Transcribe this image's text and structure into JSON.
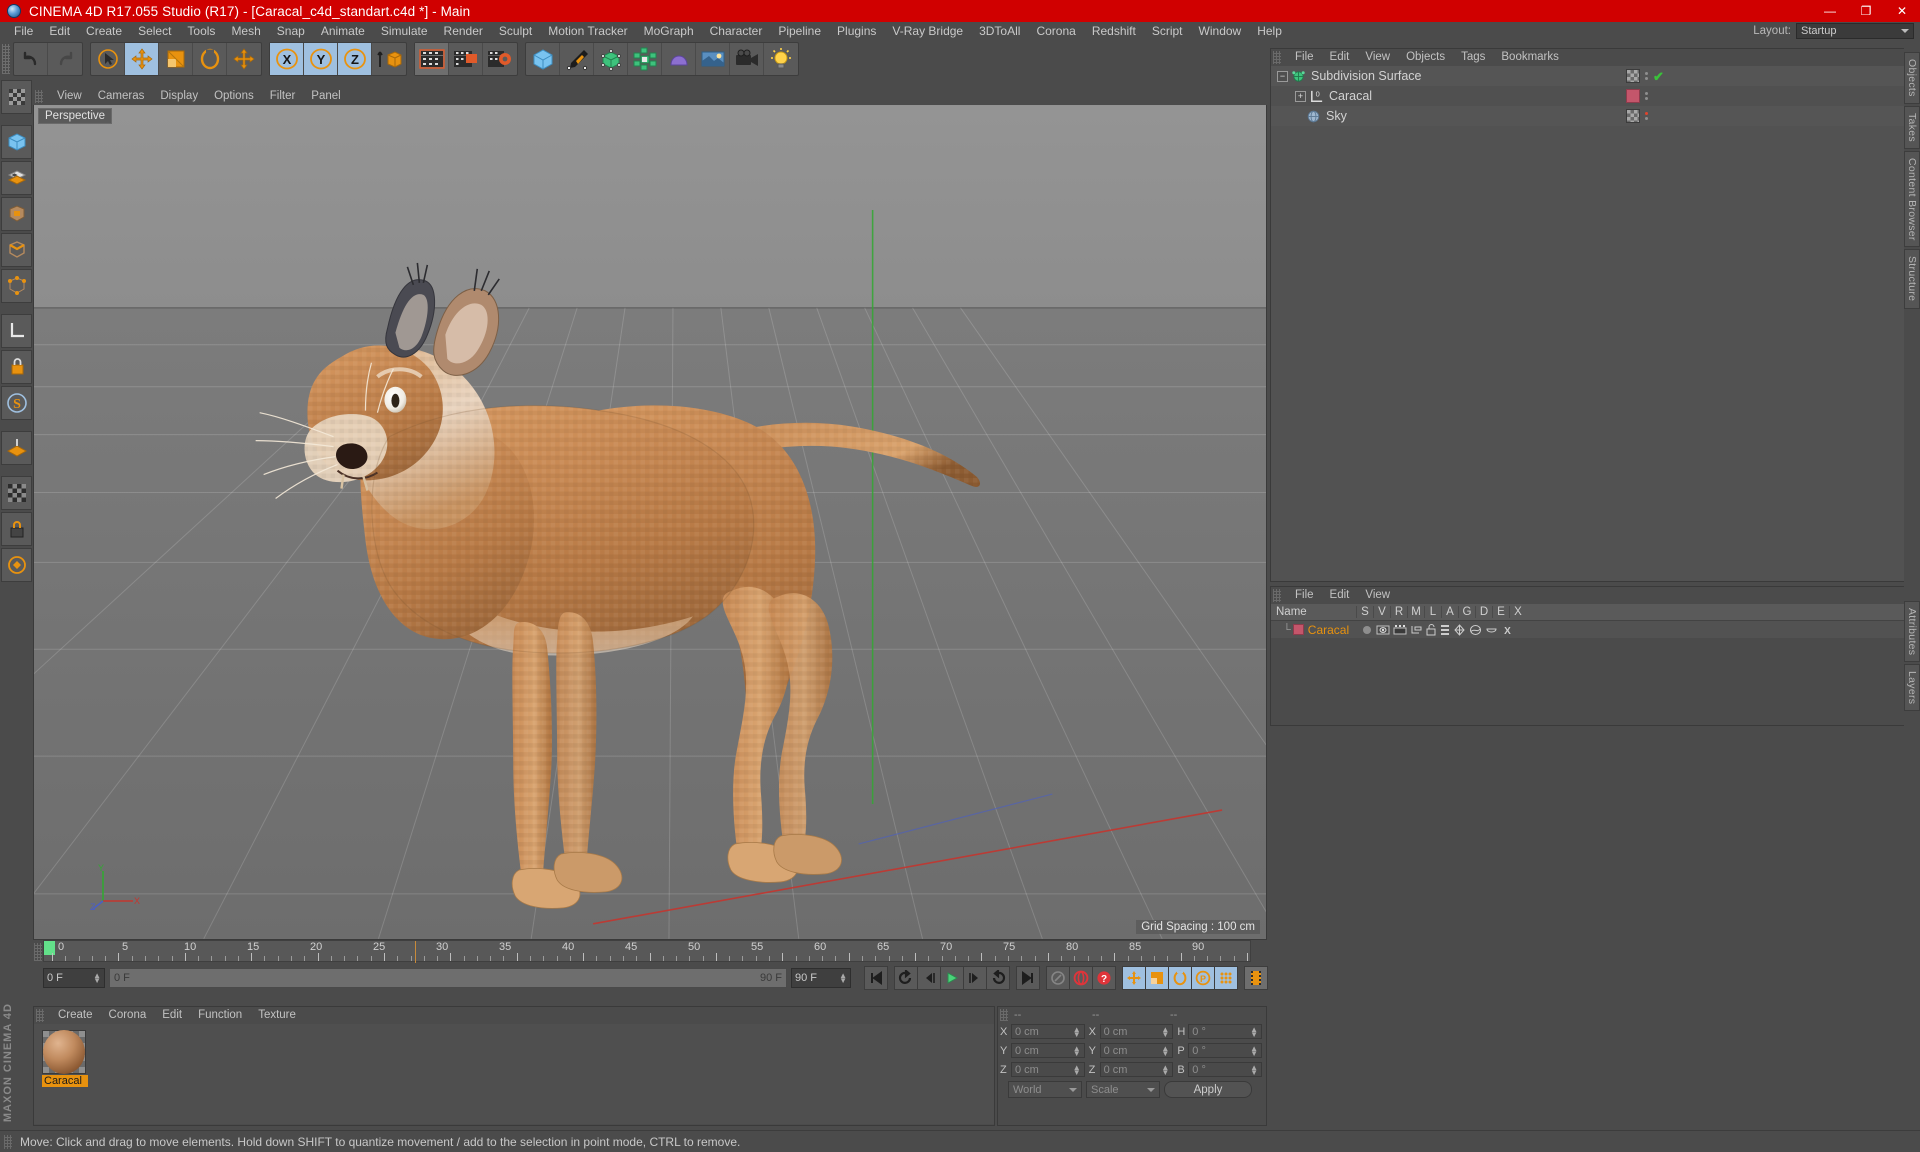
{
  "titlebar": {
    "title": "CINEMA 4D R17.055 Studio (R17) - [Caracal_c4d_standart.c4d *] - Main",
    "minimize": "—",
    "maximize": "❐",
    "close": "✕"
  },
  "menubar": {
    "items": [
      "File",
      "Edit",
      "Create",
      "Select",
      "Tools",
      "Mesh",
      "Snap",
      "Animate",
      "Simulate",
      "Render",
      "Sculpt",
      "Motion Tracker",
      "MoGraph",
      "Character",
      "Pipeline",
      "Plugins",
      "V-Ray Bridge",
      "3DToAll",
      "Corona",
      "Redshift",
      "Script",
      "Window",
      "Help"
    ],
    "layout_label": "Layout:",
    "layout_value": "Startup"
  },
  "toolbar": {
    "groups": [
      {
        "name": "history",
        "buttons": [
          {
            "name": "undo-button",
            "icon": "undo"
          },
          {
            "name": "redo-button",
            "icon": "redo"
          }
        ]
      },
      {
        "name": "modes",
        "buttons": [
          {
            "name": "select-tool-button",
            "icon": "cursor"
          },
          {
            "name": "move-tool-button",
            "icon": "move",
            "state": "selected"
          },
          {
            "name": "scale-tool-button",
            "icon": "scale"
          },
          {
            "name": "rotate-tool-button",
            "icon": "rotate"
          },
          {
            "name": "axis-tool-button",
            "icon": "axis"
          }
        ]
      },
      {
        "name": "axis-locks",
        "buttons": [
          {
            "name": "lock-x-button",
            "icon": "X",
            "state": "selected"
          },
          {
            "name": "lock-y-button",
            "icon": "Y",
            "state": "selected"
          },
          {
            "name": "lock-z-button",
            "icon": "Z",
            "state": "selected"
          },
          {
            "name": "world-object-coordinates-button",
            "icon": "world-axis"
          }
        ]
      },
      {
        "name": "render",
        "buttons": [
          {
            "name": "render-view-button",
            "icon": "clapper",
            "state": "active"
          },
          {
            "name": "render-to-picture-viewer-button",
            "icon": "clapper-pv"
          },
          {
            "name": "render-settings-button",
            "icon": "clapper-gear"
          }
        ]
      },
      {
        "name": "create",
        "buttons": [
          {
            "name": "add-cube-button",
            "icon": "cube-blue"
          },
          {
            "name": "add-spline-button",
            "icon": "pen"
          },
          {
            "name": "add-nurbs-button",
            "icon": "nurbs-green"
          },
          {
            "name": "add-array-button",
            "icon": "array-green"
          },
          {
            "name": "add-deformer-button",
            "icon": "deformer-purple"
          },
          {
            "name": "add-environment-button",
            "icon": "environment-blue"
          },
          {
            "name": "add-camera-button",
            "icon": "camera"
          },
          {
            "name": "add-light-button",
            "icon": "light-bulb"
          }
        ]
      }
    ]
  },
  "left_palette": {
    "buttons": [
      {
        "name": "texture-axis-button",
        "icon": "checker"
      },
      {
        "name": "model-mode-button",
        "icon": "model-cube"
      },
      {
        "name": "texture-mode-button",
        "icon": "texture-checker"
      },
      {
        "name": "polygon-mode-button",
        "icon": "polygon"
      },
      {
        "name": "edge-mode-button",
        "icon": "edge"
      },
      {
        "name": "point-mode-button",
        "icon": "point"
      },
      {
        "name": "enable-axis-button",
        "icon": "axis-L"
      },
      {
        "name": "lock-axis-button",
        "icon": "lock-axis"
      },
      {
        "name": "snap-settings-button",
        "icon": "snap-S"
      },
      {
        "name": "workplane-button",
        "icon": "workplane"
      },
      {
        "name": "viewport-solo-button",
        "icon": "solo-checker"
      },
      {
        "name": "lock-selection-button",
        "icon": "padlock"
      },
      {
        "name": "quantize-button",
        "icon": "quantize"
      }
    ],
    "brand": "MAXON CINEMA 4D"
  },
  "viewport": {
    "menu": [
      "View",
      "Cameras",
      "Display",
      "Options",
      "Filter",
      "Panel"
    ],
    "label": "Perspective",
    "grid_spacing": "Grid Spacing : 100 cm",
    "axis_labels": {
      "y": "Y",
      "x": "X",
      "z": "Z"
    }
  },
  "timeline": {
    "ruler_start": 0,
    "ruler_end": 90,
    "tick_labels": [
      "0",
      "5",
      "10",
      "15",
      "20",
      "25",
      "30",
      "35",
      "40",
      "45",
      "50",
      "55",
      "60",
      "65",
      "70",
      "75",
      "80",
      "85",
      "90"
    ],
    "current_frame": "0 F",
    "range_start": "0 F",
    "range_end": "90 F",
    "preview_end": "90 F",
    "playhead_frame": "0 F",
    "buttons": [
      {
        "name": "go-to-start-button",
        "icon": "skip-start"
      },
      {
        "name": "play-backwards-button",
        "icon": "rewind-round"
      },
      {
        "name": "previous-frame-button",
        "icon": "step-back"
      },
      {
        "name": "play-button",
        "icon": "play"
      },
      {
        "name": "next-frame-button",
        "icon": "step-forward"
      },
      {
        "name": "play-forward-loop-button",
        "icon": "loop"
      },
      {
        "name": "go-to-end-button",
        "icon": "skip-end"
      },
      {
        "name": "record-active-objects-button",
        "icon": "key-gray"
      },
      {
        "name": "autokeying-button",
        "icon": "record-red"
      },
      {
        "name": "keyframe-selection-button",
        "icon": "question-red"
      },
      {
        "name": "position-key-button",
        "icon": "move-key",
        "state": "selected"
      },
      {
        "name": "scale-key-button",
        "icon": "scale-key",
        "state": "selected"
      },
      {
        "name": "rotation-key-button",
        "icon": "rotate-key",
        "state": "selected"
      },
      {
        "name": "parameter-key-button",
        "icon": "param-key",
        "state": "selected"
      },
      {
        "name": "point-level-animation-button",
        "icon": "pla-dots",
        "state": "selected"
      },
      {
        "name": "timeline-view-button",
        "icon": "filmstrip",
        "state": "active"
      }
    ]
  },
  "material_manager": {
    "menu": [
      "Create",
      "Corona",
      "Edit",
      "Function",
      "Texture"
    ],
    "materials": [
      {
        "name": "Caracal"
      }
    ]
  },
  "coordinate_manager": {
    "header": [
      "--",
      "--",
      "--"
    ],
    "position": {
      "label_x": "X",
      "label_y": "Y",
      "label_z": "Z",
      "x": "0 cm",
      "y": "0 cm",
      "z": "0 cm"
    },
    "size": {
      "label_x": "X",
      "label_y": "Y",
      "label_z": "Z",
      "x": "0 cm",
      "y": "0 cm",
      "z": "0 cm"
    },
    "rotation": {
      "label_h": "H",
      "label_p": "P",
      "label_b": "B",
      "h": "0 °",
      "p": "0 °",
      "b": "0 °"
    },
    "coord_system": "World",
    "size_mode": "Scale",
    "apply_label": "Apply"
  },
  "object_manager": {
    "menu": [
      "File",
      "Edit",
      "View",
      "Objects",
      "Tags",
      "Bookmarks"
    ],
    "rows": [
      {
        "label": "Subdivision Surface",
        "icon": "subdivision-surface-icon",
        "indent": 0,
        "expander": "-",
        "tags": [
          "checker",
          "dots",
          "check"
        ]
      },
      {
        "label": "Caracal",
        "icon": "polygon-object-icon",
        "indent": 1,
        "expander": "+",
        "tags": [
          "pink",
          "dots"
        ]
      },
      {
        "label": "Sky",
        "icon": "sky-icon",
        "indent": 1,
        "expander": "",
        "tags": [
          "checker",
          "dots-red"
        ]
      }
    ]
  },
  "layer_manager": {
    "menu": [
      "File",
      "Edit",
      "View"
    ],
    "columns": [
      "Name",
      "S",
      "V",
      "R",
      "M",
      "L",
      "A",
      "G",
      "D",
      "E",
      "X"
    ],
    "rows": [
      {
        "name": "Caracal",
        "color": "#c4566b"
      }
    ]
  },
  "right_tabs": [
    "Objects",
    "Takes",
    "Content Browser",
    "Structure",
    "Attributes",
    "Layers"
  ],
  "statusbar": {
    "message": "Move: Click and drag to move elements. Hold down SHIFT to quantize movement / add to the selection in point mode, CTRL to remove."
  },
  "colors": {
    "accent_red": "#d00000",
    "panel_bg": "#4b4b4b",
    "selection_blue": "#9fc0e0",
    "material_orange": "#e8920f",
    "layer_pink": "#c4566b"
  }
}
